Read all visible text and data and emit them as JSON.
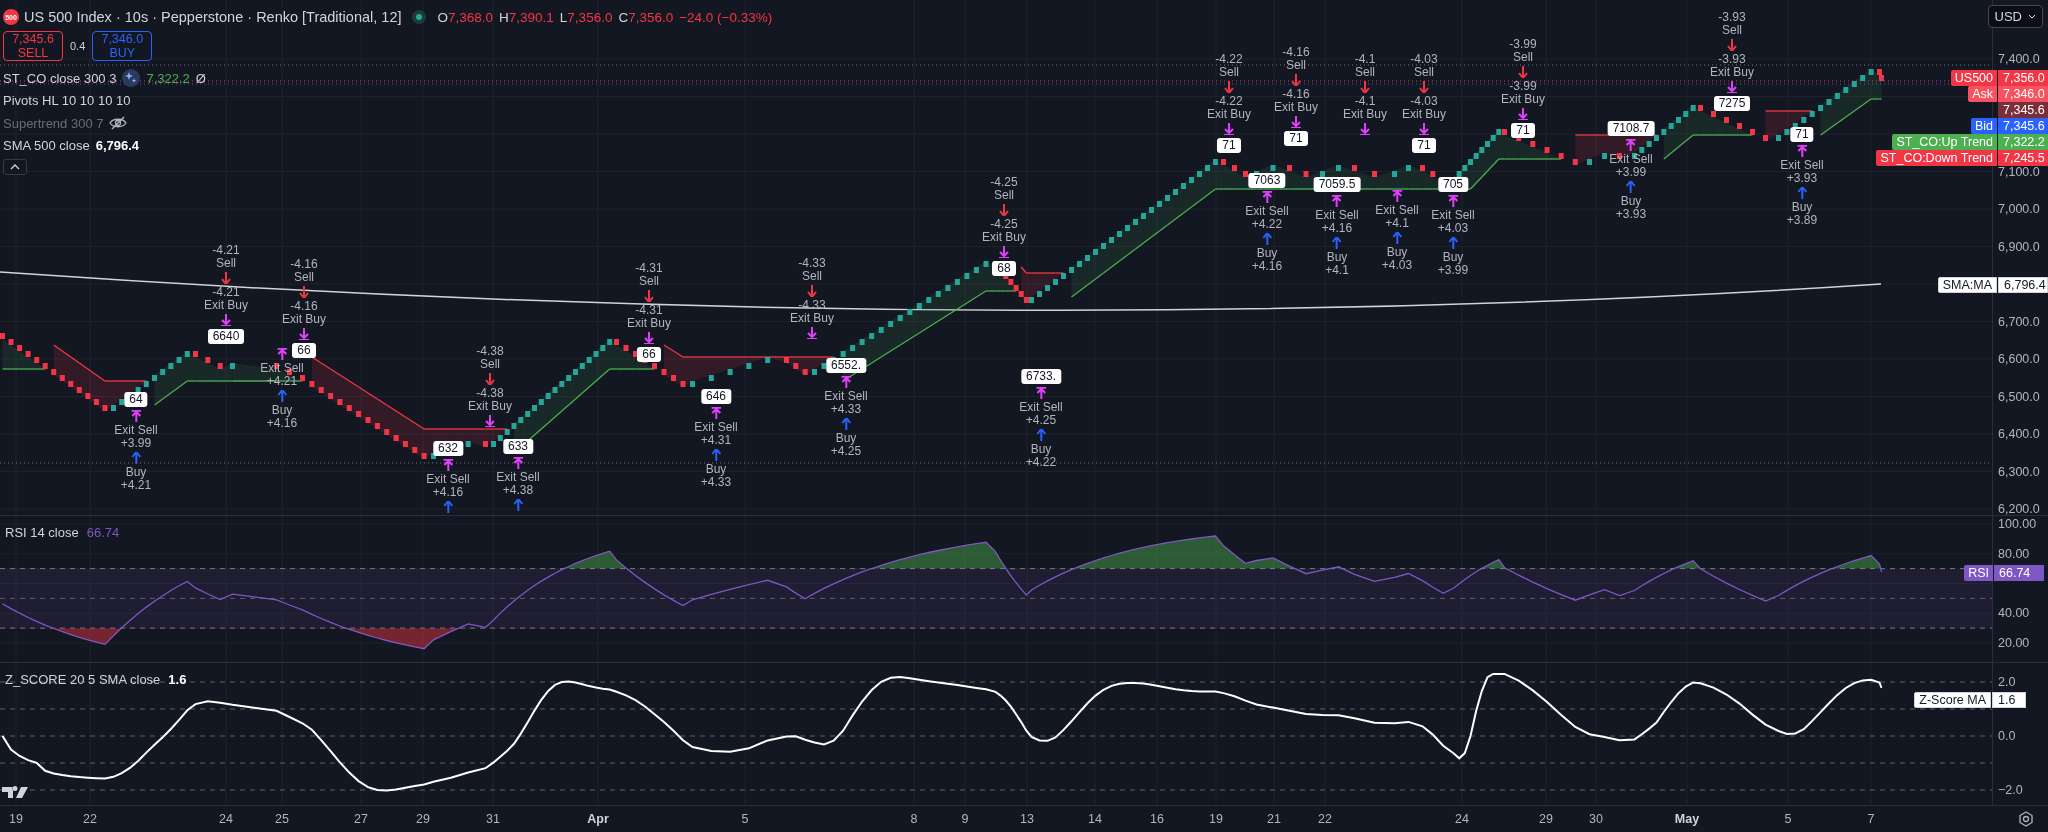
{
  "header": {
    "symbol_badge": "500",
    "title": "US 500 Index · 10s · Pepperstone · Renko [Traditional, 12]",
    "market_open": true,
    "ohlc": [
      {
        "key": "O",
        "value": "7,368.0"
      },
      {
        "key": "H",
        "value": "7,390.1"
      },
      {
        "key": "L",
        "value": "7,356.0"
      },
      {
        "key": "C",
        "value": "7,356.0"
      }
    ],
    "change": "−24.0 (−0.33%)"
  },
  "trade": {
    "sell": {
      "price": "7,345.6",
      "label": "SELL"
    },
    "spread": "0.4",
    "buy": {
      "price": "7,346.0",
      "label": "BUY"
    }
  },
  "indicators": [
    {
      "name": "ST_CO close 300 3",
      "kind": "sparkle",
      "value": "7,322.2",
      "color": "#4caf50",
      "suffix": "Ø",
      "hidden": false
    },
    {
      "name": "Pivots HL 10 10 10 10",
      "kind": "plain",
      "hidden": false
    },
    {
      "name": "Supertrend 300 7",
      "kind": "plain",
      "hidden": true
    },
    {
      "name": "SMA 500 close",
      "kind": "plain",
      "value": "6,796.4",
      "color": "#ffffff",
      "hidden": false
    }
  ],
  "currency": "USD",
  "price_axis": {
    "ticks": [
      "7,400.0",
      "7,100.0",
      "7,000.0",
      "6,900.0",
      "6,700.0",
      "6,600.0",
      "6,500.0",
      "6,400.0",
      "6,300.0",
      "6,200.0"
    ],
    "tags": [
      {
        "name": "US500",
        "value": "7,356.0",
        "color": "#f23645"
      },
      {
        "name": "Ask",
        "value": "7,346.0",
        "color": "#f7525f"
      },
      {
        "value": "7,345.6",
        "color": "#7a2e3a"
      },
      {
        "name": "Bid",
        "value": "7,345.6",
        "color": "#2962ff"
      },
      {
        "name": "ST_CO:Up Trend",
        "value": "7,322.2",
        "color": "#4caf50"
      },
      {
        "name": "ST_CO:Down Trend",
        "value": "7,245.5",
        "color": "#f23645"
      }
    ],
    "sma_tag": {
      "name": "SMA:MA",
      "value": "6,796.4"
    }
  },
  "sell_signals": [
    {
      "value": "-4.21",
      "label": "Sell",
      "exit_value": "-4.21",
      "exit_label": "Exit Buy",
      "pivot": "6640"
    },
    {
      "value": "-4.16",
      "label": "Sell",
      "exit_value": "-4.16",
      "exit_label": "Exit Buy",
      "pivot": "66"
    },
    {
      "value": "-4.38",
      "label": "Sell",
      "exit_value": "-4.38",
      "exit_label": "Exit Buy"
    },
    {
      "value": "-4.31",
      "label": "Sell",
      "exit_value": "-4.31",
      "exit_label": "Exit Buy",
      "pivot": "66"
    },
    {
      "value": "-4.33",
      "label": "Sell",
      "exit_value": "-4.33",
      "exit_label": "Exit Buy"
    },
    {
      "value": "-4.25",
      "label": "Sell",
      "exit_value": "-4.25",
      "exit_label": "Exit Buy",
      "pivot": "68"
    },
    {
      "value": "-4.22",
      "label": "Sell",
      "exit_value": "-4.22",
      "exit_label": "Exit Buy",
      "pivot": "71"
    },
    {
      "value": "-4.16",
      "label": "Sell",
      "exit_value": "-4.16",
      "exit_label": "Exit Buy",
      "pivot": "71"
    },
    {
      "value": "-4.1",
      "label": "Sell",
      "exit_value": "-4.1",
      "exit_label": "Exit Buy"
    },
    {
      "value": "-4.03",
      "label": "Sell",
      "exit_value": "-4.03",
      "exit_label": "Exit Buy",
      "pivot": "71"
    },
    {
      "value": "-3.99",
      "label": "Sell",
      "exit_value": "-3.99",
      "exit_label": "Exit Buy",
      "pivot": "71"
    },
    {
      "value": "-3.93",
      "label": "Sell",
      "exit_value": "-3.93",
      "exit_label": "Exit Buy",
      "pivot": "7275"
    }
  ],
  "buy_signals": [
    {
      "exit_label": "Exit Sell",
      "exit_value": "+3.99",
      "label": "Buy",
      "value": "+4.21",
      "pivot": "64"
    },
    {
      "exit_label": "Exit Sell",
      "exit_value": "+4.21",
      "label": "Buy",
      "value": "+4.16"
    },
    {
      "exit_label": "Exit Sell",
      "exit_value": "+4.16",
      "pivot": "632"
    },
    {
      "exit_label": "Exit Sell",
      "exit_value": "+4.38",
      "pivot": "633"
    },
    {
      "exit_label": "Exit Sell",
      "exit_value": "+4.31",
      "label": "Buy",
      "value": "+4.33",
      "pivot": "646"
    },
    {
      "exit_label": "Exit Sell",
      "exit_value": "+4.33",
      "label": "Buy",
      "value": "+4.25",
      "pivot": "6552."
    },
    {
      "exit_label": "Exit Sell",
      "exit_value": "+4.25",
      "label": "Buy",
      "value": "+4.22",
      "pivot": "6733."
    },
    {
      "exit_label": "Exit Sell",
      "exit_value": "+4.22",
      "label": "Buy",
      "value": "+4.16",
      "pivot": "7063"
    },
    {
      "exit_label": "Exit Sell",
      "exit_value": "+4.16",
      "label": "Buy",
      "value": "+4.1",
      "pivot": "7059.5"
    },
    {
      "exit_label": "Exit Sell",
      "exit_value": "+4.1",
      "label": "Buy",
      "value": "+4.03"
    },
    {
      "exit_label": "Exit Sell",
      "exit_value": "+4.03",
      "label": "Buy",
      "value": "+3.99",
      "pivot": "705"
    },
    {
      "exit_label": "Exit Sell",
      "exit_value": "+3.99",
      "label": "Buy",
      "value": "+3.93",
      "pivot": "7108.7"
    },
    {
      "exit_label": "Exit Sell",
      "exit_value": "+3.93",
      "label": "Buy",
      "value": "+3.89",
      "pivot": "71"
    }
  ],
  "rsi": {
    "name": "RSI 14 close",
    "value": "66.74",
    "ticks": [
      "100.00",
      "80.00",
      "40.00",
      "20.00"
    ],
    "tag": {
      "name": "RSI",
      "value": "66.74"
    }
  },
  "zscore": {
    "name": "Z_SCORE 20 5 SMA close",
    "value": "1.6",
    "ticks": [
      "2.0",
      "0.0",
      "−2.0"
    ],
    "tag": {
      "name": "Z-Score MA",
      "value": "1.6"
    }
  },
  "time_axis": [
    {
      "label": "19",
      "kind": "day"
    },
    {
      "label": "22",
      "kind": "day"
    },
    {
      "label": "24",
      "kind": "day"
    },
    {
      "label": "25",
      "kind": "day"
    },
    {
      "label": "27",
      "kind": "day"
    },
    {
      "label": "29",
      "kind": "day"
    },
    {
      "label": "31",
      "kind": "day"
    },
    {
      "label": "Apr",
      "kind": "month"
    },
    {
      "label": "5",
      "kind": "day"
    },
    {
      "label": "8",
      "kind": "day"
    },
    {
      "label": "9",
      "kind": "day"
    },
    {
      "label": "13",
      "kind": "day"
    },
    {
      "label": "14",
      "kind": "day"
    },
    {
      "label": "16",
      "kind": "day"
    },
    {
      "label": "19",
      "kind": "day"
    },
    {
      "label": "21",
      "kind": "day"
    },
    {
      "label": "22",
      "kind": "day"
    },
    {
      "label": "24",
      "kind": "day"
    },
    {
      "label": "29",
      "kind": "day"
    },
    {
      "label": "30",
      "kind": "day"
    },
    {
      "label": "May",
      "kind": "month"
    },
    {
      "label": "5",
      "kind": "day"
    },
    {
      "label": "7",
      "kind": "day"
    }
  ]
}
